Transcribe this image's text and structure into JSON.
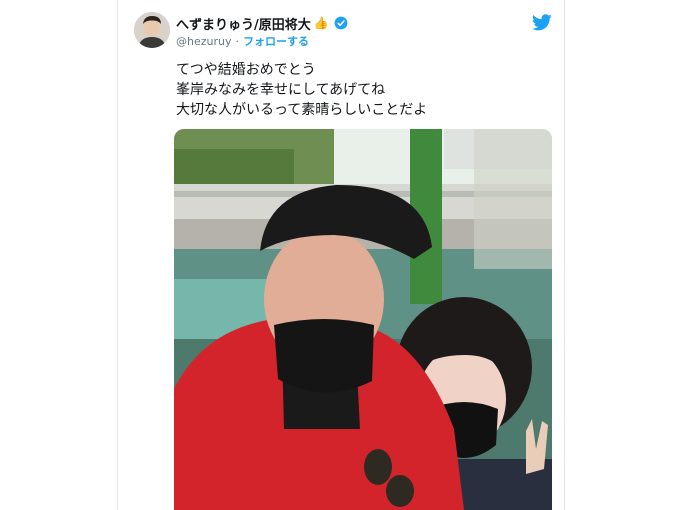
{
  "tweet": {
    "display_name": "へずまりゅう/原田将大",
    "name_emoji": "👍",
    "handle": "@hezuruy",
    "separator": "·",
    "follow_label": "フォローする",
    "text_lines": [
      "てつや結婚おめでとう",
      "峯岸みなみを幸せにしてあげてね",
      "大切な人がいるって素晴らしいことだよ"
    ]
  },
  "icons": {
    "verified": "verified-badge-icon",
    "platform": "twitter-bird-icon"
  },
  "colors": {
    "accent": "#1da1f2",
    "text": "#14171a",
    "secondary_text": "#657786",
    "border": "#e1e8ed"
  }
}
